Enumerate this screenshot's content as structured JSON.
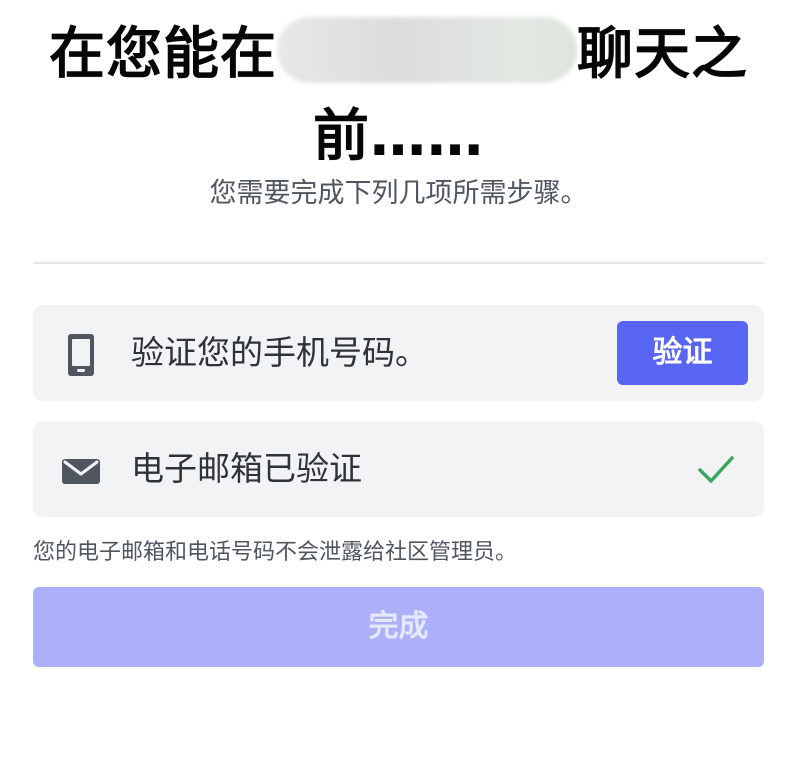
{
  "header": {
    "title_part1": "在您能在",
    "title_part2": "聊天之前……",
    "subtitle": "您需要完成下列几项所需步骤。"
  },
  "steps": [
    {
      "icon": "mobile-phone-icon",
      "label": "验证您的手机号码。",
      "action_label": "验证"
    },
    {
      "icon": "envelope-icon",
      "label": "电子邮箱已验证",
      "status_icon": "checkmark-icon"
    }
  ],
  "privacy_note": "您的电子邮箱和电话号码不会泄露给社区管理员。",
  "done_button": "完成",
  "colors": {
    "brand": "#5865f2",
    "brand_disabled": "#abb0f9",
    "success": "#3ba55c",
    "row_background": "#f2f3f5",
    "icon": "#4f5660"
  }
}
